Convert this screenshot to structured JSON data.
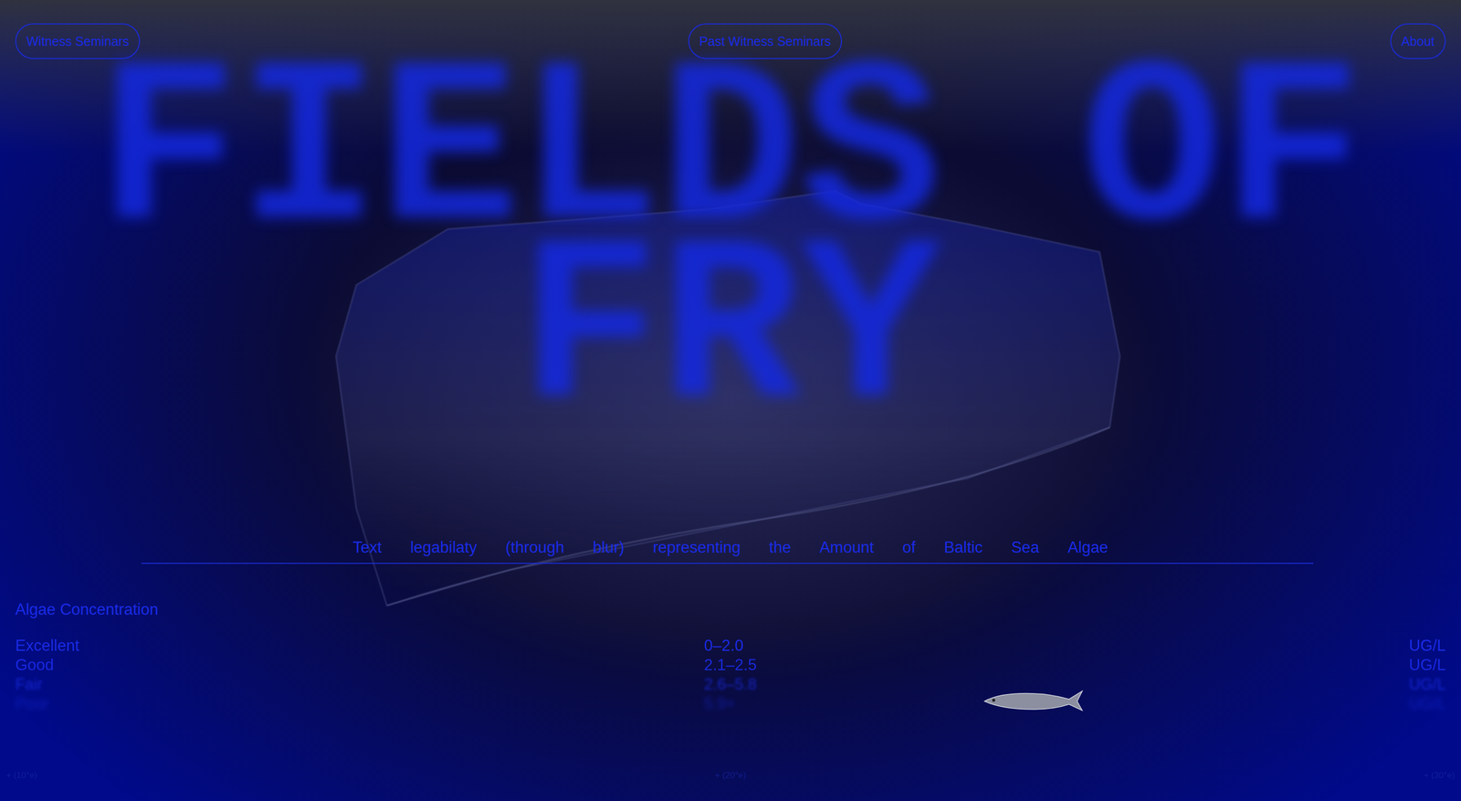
{
  "nav": [
    {
      "label": "Witness Seminars"
    },
    {
      "label": "Past Witness Seminars"
    },
    {
      "label": "About"
    }
  ],
  "title": {
    "lines": [
      "FIELDS OF",
      "FRY"
    ]
  },
  "caption": {
    "words": [
      "Text",
      "legabilaty",
      "(through",
      "blur)",
      "representing",
      "the",
      "Amount",
      "of",
      "Baltic",
      "Sea",
      "Algae"
    ]
  },
  "legend": {
    "title": "Algae Concentration",
    "rows": [
      {
        "label": "Excellent",
        "range": "0–2.0",
        "unit": "UG/L",
        "level": 0
      },
      {
        "label": "Good",
        "range": "2.1–2.5",
        "unit": "UG/L",
        "level": 0.15
      },
      {
        "label": "Fair",
        "range": "2.6–5.8",
        "unit": "UG/L",
        "level": 0.5
      },
      {
        "label": "Poor",
        "range": "5.9+",
        "unit": "UG/L",
        "level": 1
      }
    ]
  },
  "markers": [
    "+ (10°e)",
    "+ (20°e)",
    "+ (30°e)"
  ]
}
